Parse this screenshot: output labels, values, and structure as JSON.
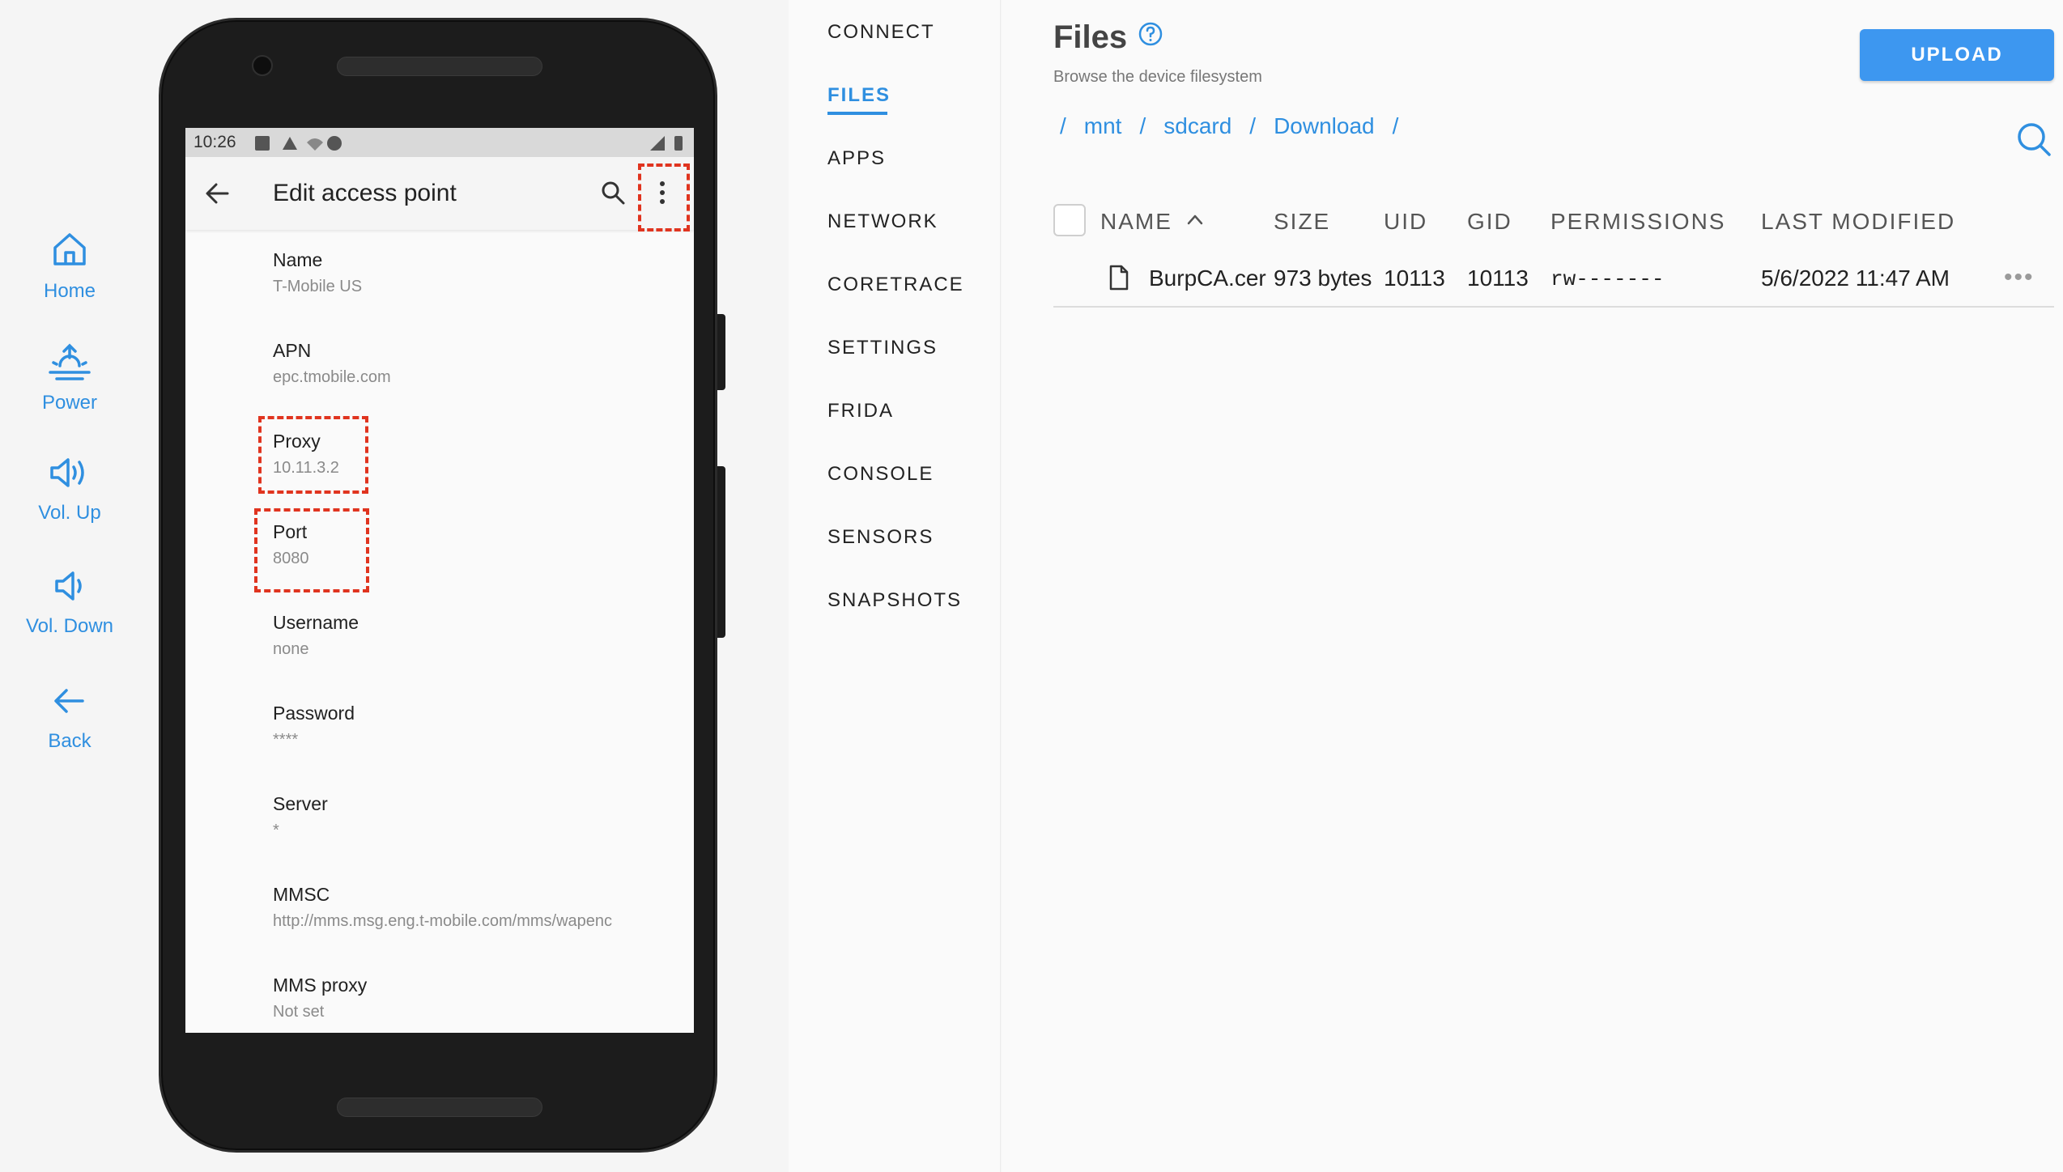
{
  "controls": [
    {
      "label": "Home",
      "icon": "home-icon"
    },
    {
      "label": "Power",
      "icon": "power-icon"
    },
    {
      "label": "Vol. Up",
      "icon": "volume-up-icon"
    },
    {
      "label": "Vol. Down",
      "icon": "volume-down-icon"
    },
    {
      "label": "Back",
      "icon": "back-arrow-icon"
    }
  ],
  "phone": {
    "status_time": "10:26",
    "app_title": "Edit access point",
    "apn_items": [
      {
        "title": "Name",
        "value": "T-Mobile US"
      },
      {
        "title": "APN",
        "value": "epc.tmobile.com"
      },
      {
        "title": "Proxy",
        "value": "10.11.3.2"
      },
      {
        "title": "Port",
        "value": "8080"
      },
      {
        "title": "Username",
        "value": "none"
      },
      {
        "title": "Password",
        "value": "****"
      },
      {
        "title": "Server",
        "value": "*"
      },
      {
        "title": "MMSC",
        "value": "http://mms.msg.eng.t-mobile.com/mms/wapenc"
      },
      {
        "title": "MMS proxy",
        "value": "Not set"
      }
    ]
  },
  "nav": {
    "items": [
      "CONNECT",
      "FILES",
      "APPS",
      "NETWORK",
      "CORETRACE",
      "SETTINGS",
      "FRIDA",
      "CONSOLE",
      "SENSORS",
      "SNAPSHOTS"
    ],
    "active": "FILES"
  },
  "files": {
    "title": "Files",
    "subtitle": "Browse the device filesystem",
    "upload_label": "UPLOAD",
    "breadcrumb": [
      "mnt",
      "sdcard",
      "Download"
    ],
    "breadcrumb_sep": "/",
    "columns": [
      "NAME",
      "SIZE",
      "UID",
      "GID",
      "PERMISSIONS",
      "LAST MODIFIED"
    ],
    "rows": [
      {
        "name": "BurpCA.cer",
        "size": "973 bytes",
        "uid": "10113",
        "gid": "10113",
        "permissions": "rw-------",
        "modified": "5/6/2022 11:47 AM"
      }
    ],
    "row_menu": "•••"
  },
  "colors": {
    "accent": "#2f8fe0",
    "highlight": "#e0341f",
    "button": "#3d97f0"
  }
}
